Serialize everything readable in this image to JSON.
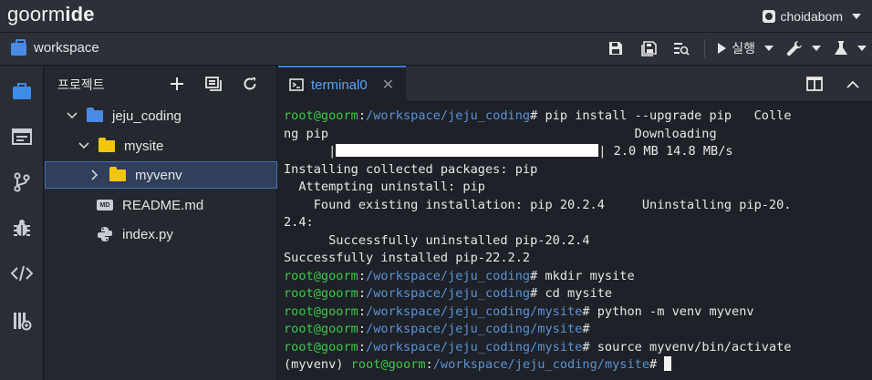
{
  "app": {
    "brand_light": "goorm",
    "brand_bold": "ide",
    "user": "choidabom"
  },
  "workspace": {
    "title": "workspace",
    "run_label": "실행"
  },
  "project": {
    "title": "프로젝트",
    "tree": [
      {
        "label": "jeju_coding"
      },
      {
        "label": "mysite"
      },
      {
        "label": "myvenv"
      },
      {
        "label": "README.md"
      },
      {
        "label": "index.py"
      }
    ]
  },
  "terminal": {
    "tab_label": "terminal0",
    "lines": {
      "l1_prompt": "root@goorm",
      "l1_path": "/workspace/jeju_coding",
      "l1_cmd": "# pip install --upgrade pip   Colle",
      "l2": "ng pip                                         Downloading",
      "l3a": "      |",
      "l3b": "| 2.0 MB 14.8 MB/s",
      "l4": "Installing collected packages: pip",
      "l5": "  Attempting uninstall: pip",
      "l6": "    Found existing installation: pip 20.2.4     Uninstalling pip-20.",
      "l7": "2.4:",
      "l8": "      Successfully uninstalled pip-20.2.4",
      "l9": "Successfully installed pip-22.2.2",
      "l10_prompt": "root@goorm",
      "l10_path": "/workspace/jeju_coding",
      "l10_cmd": "# mkdir mysite",
      "l11_prompt": "root@goorm",
      "l11_path": "/workspace/jeju_coding",
      "l11_cmd": "# cd mysite",
      "l12_prompt": "root@goorm",
      "l12_path": "/workspace/jeju_coding/mysite",
      "l12_cmd": "# python -m venv myvenv",
      "l13_prompt": "root@goorm",
      "l13_path": "/workspace/jeju_coding/mysite",
      "l13_cmd": "#",
      "l14_prompt": "root@goorm",
      "l14_path": "/workspace/jeju_coding/mysite",
      "l14_cmd": "# source myvenv/bin/activate",
      "l15_env": "(myvenv) ",
      "l15_prompt": "root@goorm",
      "l15_path": "/workspace/jeju_coding/mysite",
      "l15_cmd": "# "
    }
  },
  "colors": {
    "accent": "#3d7de0",
    "prompt_green": "#3ec94a",
    "path_blue": "#5b93d6",
    "folder_yellow": "#f2c511"
  }
}
